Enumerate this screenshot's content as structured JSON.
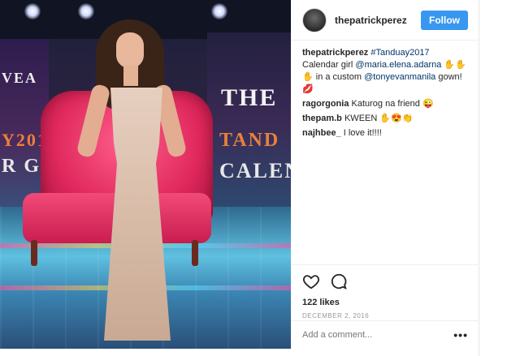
{
  "post": {
    "username": "thepatrickperez",
    "follow_label": "Follow",
    "likes": "122 likes",
    "date": "DECEMBER 2, 2016",
    "add_comment_placeholder": "Add a comment...",
    "more_label": "•••"
  },
  "photo": {
    "sign_the": "THE",
    "sign_tand": "TAND",
    "sign_cale": "CALEN",
    "sign_vea": "VEA",
    "sign_y20": "Y201",
    "sign_rgi": "R GIR"
  },
  "comments": [
    {
      "author": "thepatrickperez",
      "parts": [
        {
          "type": "hashtag",
          "text": "#Tanduay2017"
        },
        {
          "type": "text",
          "text": " Calendar girl "
        },
        {
          "type": "mention",
          "text": "@maria.elena.adarna"
        },
        {
          "type": "text",
          "text": " ✋✋✋ in a custom "
        },
        {
          "type": "mention",
          "text": "@tonyevanmanila"
        },
        {
          "type": "text",
          "text": " gown! 💋"
        }
      ]
    },
    {
      "author": "ragorgonia",
      "parts": [
        {
          "type": "text",
          "text": "Katurog na friend 😜"
        }
      ]
    },
    {
      "author": "thepam.b",
      "parts": [
        {
          "type": "text",
          "text": "KWEEN ✋😍👏"
        }
      ]
    },
    {
      "author": "najhbee_",
      "parts": [
        {
          "type": "text",
          "text": "I love it!!!!"
        }
      ]
    }
  ],
  "icons": {
    "like": "heart-outline-icon",
    "comment": "speech-bubble-icon",
    "more": "more-horizontal-icon"
  },
  "colors": {
    "follow_button": "#3897f0",
    "mention": "#003569",
    "muted_text": "#999999"
  }
}
